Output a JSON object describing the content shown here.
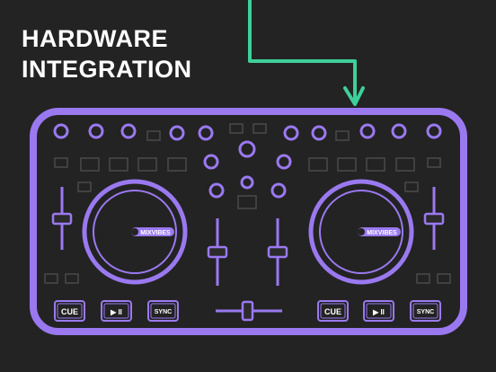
{
  "headline": {
    "line1": "HARDWARE",
    "line2": "INTEGRATION"
  },
  "colors": {
    "background": "#232323",
    "controller": "#9a79f0",
    "button_fill": "#2b2b2b",
    "arrow": "#3ecf9a",
    "text": "#ffffff"
  },
  "controller": {
    "left_deck": {
      "platter_label": "MIXVIBES",
      "cue_label": "CUE",
      "play_label": "▶ II",
      "sync_label": "SYNC"
    },
    "right_deck": {
      "platter_label": "MIXVIBES",
      "cue_label": "CUE",
      "play_label": "▶ II",
      "sync_label": "SYNC"
    }
  },
  "icons": {
    "arrow": "down-arrow-icon"
  }
}
